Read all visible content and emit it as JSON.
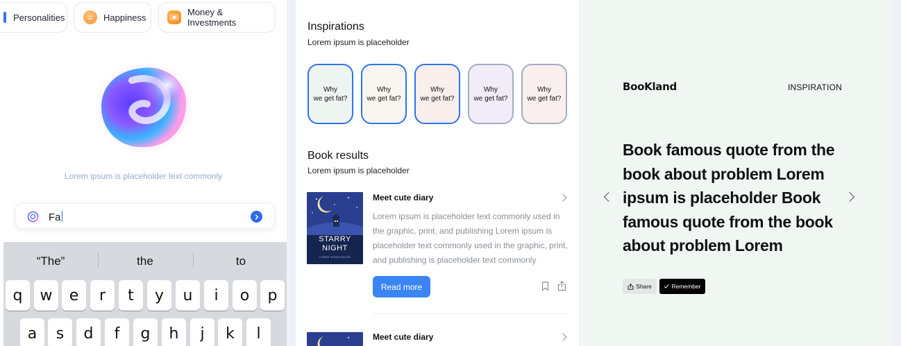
{
  "categories": [
    {
      "label": "Personalities",
      "icon": "bar-icon"
    },
    {
      "label": "Happiness",
      "icon": "smiley-icon"
    },
    {
      "label": "Money & Investments",
      "icon": "money-icon"
    }
  ],
  "assistant": {
    "caption": "Lorem ipsum is placeholder text commonly",
    "search_value": "Fa"
  },
  "keyboard": {
    "suggestions": [
      "“The”",
      "the",
      "to"
    ],
    "row1": [
      "q",
      "w",
      "e",
      "r",
      "t",
      "y",
      "u",
      "i",
      "o",
      "p"
    ],
    "row2": [
      "a",
      "s",
      "d",
      "f",
      "g",
      "h",
      "j",
      "k",
      "l"
    ]
  },
  "inspirations": {
    "title": "Inspirations",
    "subtitle": "Lorem ipsum is placeholder",
    "cards": [
      {
        "line1": "Why",
        "line2": "we get fat?",
        "bg": "#eef5f1"
      },
      {
        "line1": "Why",
        "line2": "we get fat?",
        "bg": "#f8f6ee"
      },
      {
        "line1": "Why",
        "line2": "we get fat?",
        "bg": "#f8efec"
      },
      {
        "line1": "Why",
        "line2": "we get fat?",
        "bg": "#f1ecf8"
      },
      {
        "line1": "Why",
        "line2": "we get fat?",
        "bg": "#f8efee"
      }
    ]
  },
  "book_results": {
    "title": "Book results",
    "subtitle": "Lorem ipsum is placeholder",
    "items": [
      {
        "title": "Meet cute diary",
        "cover_title_1": "STARRY",
        "cover_title_2": "NIGHT",
        "cover_author": "LOREM IPSUM DOLOR",
        "description": "Lorem ipsum is placeholder text commonly used in the graphic, print, and publishing Lorem ipsum is placeholder text commonly used in the graphic, print, and publishing is placeholder text commonly",
        "read_more": "Read more"
      },
      {
        "title": "Meet cute diary"
      }
    ]
  },
  "quote_panel": {
    "logo": "BooKland",
    "nav_label": "INSPIRATION",
    "quote": "Book famous quote from the book about problem Lorem ipsum is placeholder Book famous quote from the book about problem Lorem",
    "share_label": "Share",
    "remember_label": "Remember"
  },
  "colors": {
    "accent": "#3a84f4",
    "quote_bg": "#f0f7f3",
    "keyboard_bg": "#d6d9de"
  }
}
